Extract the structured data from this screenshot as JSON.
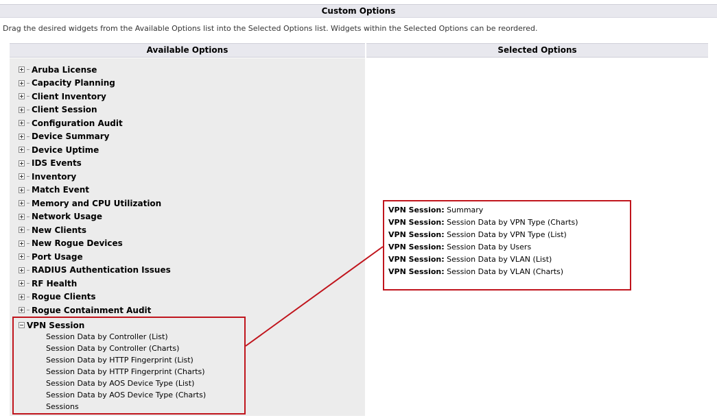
{
  "header": {
    "title": "Custom Options",
    "instructions": "Drag the desired widgets from the Available Options list into the Selected Options list. Widgets within the Selected Options can be reordered."
  },
  "columns": {
    "available": "Available Options",
    "selected": "Selected Options"
  },
  "available_options": [
    "Aruba License",
    "Capacity Planning",
    "Client Inventory",
    "Client Session",
    "Configuration Audit",
    "Device Summary",
    "Device Uptime",
    "IDS Events",
    "Inventory",
    "Match Event",
    "Memory and CPU Utilization",
    "Network Usage",
    "New Clients",
    "New Rogue Devices",
    "Port Usage",
    "RADIUS Authentication Issues",
    "RF Health",
    "Rogue Clients",
    "Rogue Containment Audit"
  ],
  "expanded_group": {
    "label": "VPN Session",
    "children": [
      "Session Data by Controller (List)",
      "Session Data by Controller (Charts)",
      "Session Data by HTTP Fingerprint (List)",
      "Session Data by HTTP Fingerprint (Charts)",
      "Session Data by AOS Device Type (List)",
      "Session Data by AOS Device Type (Charts)",
      "Sessions"
    ]
  },
  "selected_options": [
    {
      "prefix": "VPN Session:",
      "label": "Summary"
    },
    {
      "prefix": "VPN Session:",
      "label": "Session Data by VPN Type (Charts)"
    },
    {
      "prefix": "VPN Session:",
      "label": "Session Data by VPN Type (List)"
    },
    {
      "prefix": "VPN Session:",
      "label": "Session Data by Users"
    },
    {
      "prefix": "VPN Session:",
      "label": "Session Data by VLAN (List)"
    },
    {
      "prefix": "VPN Session:",
      "label": "Session Data by VLAN (Charts)"
    }
  ],
  "colors": {
    "highlight": "#c0141c",
    "header_bg": "#e8e8ee",
    "available_bg": "#ececec"
  }
}
